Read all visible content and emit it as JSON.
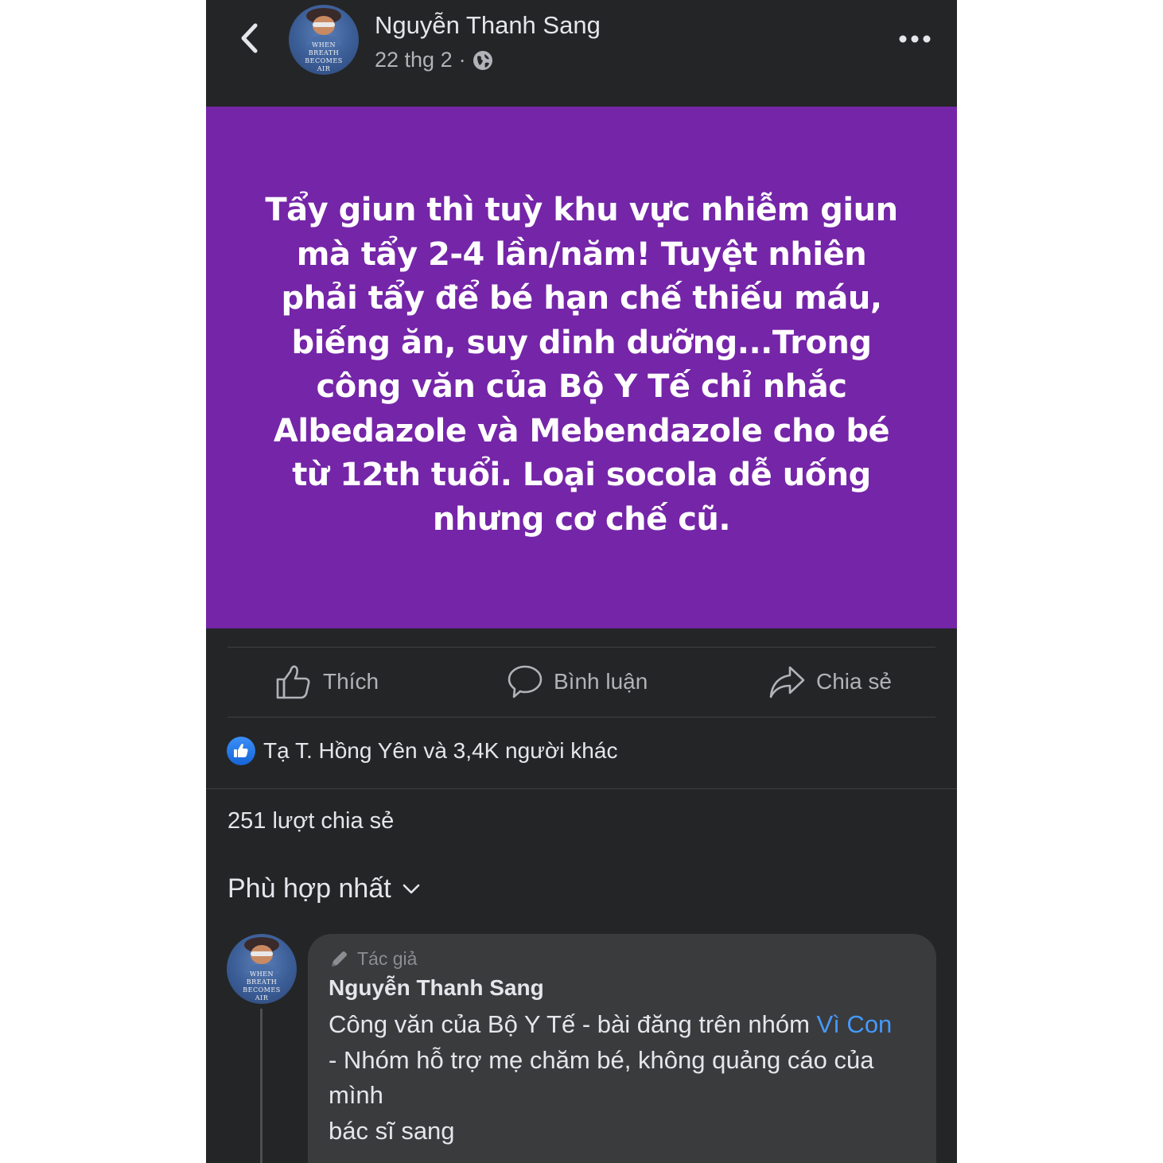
{
  "header": {
    "author_name": "Nguyễn Thanh Sang",
    "date": "22 thg 2",
    "separator": "·",
    "privacy_icon": "globe-icon",
    "back_icon": "chevron-left-icon",
    "more_icon": "more-horizontal-icon",
    "avatar_text": [
      "WHEN",
      "BREATH",
      "BECOMES",
      "AIR"
    ]
  },
  "post": {
    "background_color": "#7525a8",
    "text": "Tẩy giun thì tuỳ khu vực nhiễm giun mà tẩy 2-4 lần/năm! Tuyệt nhiên phải tẩy để bé hạn chế thiếu máu, biếng ăn, suy dinh dưỡng...Trong công văn của Bộ Y Tế chỉ nhắc Albedazole và Mebendazole cho bé từ 12th tuổi. Loại socola dễ uống nhưng cơ chế cũ."
  },
  "actions": {
    "like_label": "Thích",
    "comment_label": "Bình luận",
    "share_label": "Chia sẻ"
  },
  "reactions": {
    "summary": "Tạ T. Hồng Yên và 3,4K người khác"
  },
  "shares": {
    "text": "251 lượt chia sẻ"
  },
  "sort": {
    "label": "Phù hợp nhất"
  },
  "comment": {
    "author_tag": "Tác giả",
    "author_name": "Nguyễn Thanh Sang",
    "text_part1": "Công văn của Bộ Y Tế - bài đăng trên nhóm ",
    "link_text": "Vì Con",
    "text_part2": " - Nhóm hỗ trợ mẹ chăm bé, không quảng cáo của mình",
    "text_line_last": "bác sĩ sang"
  },
  "colors": {
    "background": "#242526",
    "bubble": "#3a3b3c",
    "link": "#4599ff",
    "like_blue": "#1877f2"
  }
}
